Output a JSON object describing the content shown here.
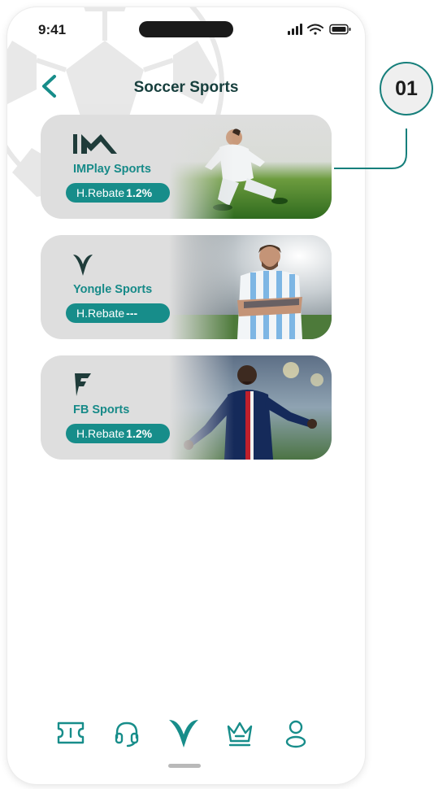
{
  "status_bar": {
    "time": "9:41"
  },
  "header": {
    "title": "Soccer Sports"
  },
  "providers": [
    {
      "name": "IMPlay Sports",
      "rebate_label": "H.Rebate",
      "rebate_value": "1.2%",
      "logo_icon": "im-logo-icon"
    },
    {
      "name": "Yongle Sports",
      "rebate_label": "H.Rebate",
      "rebate_value": "---",
      "logo_icon": "yongle-logo-icon"
    },
    {
      "name": "FB Sports",
      "rebate_label": "H.Rebate",
      "rebate_value": "1.2%",
      "logo_icon": "fb-logo-icon"
    }
  ],
  "tabbar": {
    "items": [
      {
        "icon": "ticket-icon",
        "active": false
      },
      {
        "icon": "headset-icon",
        "active": false
      },
      {
        "icon": "sports-icon",
        "active": true
      },
      {
        "icon": "crown-icon",
        "active": false
      },
      {
        "icon": "profile-icon",
        "active": false
      }
    ]
  },
  "annotation": {
    "badge": "01"
  },
  "colors": {
    "accent": "#178d8a",
    "title": "#173f3d",
    "card_bg": "#dedede"
  }
}
